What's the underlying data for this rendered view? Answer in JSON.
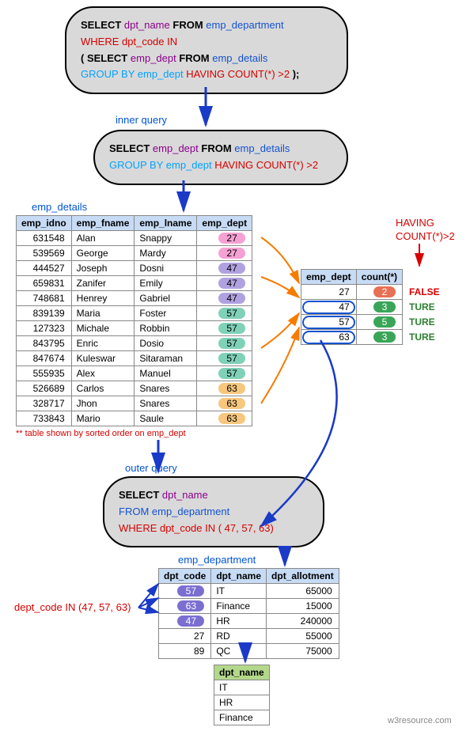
{
  "main_query": {
    "line1_select": "SELECT",
    "line1_col": "dpt_name",
    "line1_from": "FROM",
    "line1_tbl": "emp_department",
    "line2_where": "WHERE",
    "line2_rest": "dpt_code IN",
    "line3_open": "(",
    "line3_select": "SELECT",
    "line3_col": "emp_dept",
    "line3_from": "FROM",
    "line3_tbl": "emp_details",
    "line4_group": "GROUP BY",
    "line4_col": "emp_dept",
    "line4_having": "HAVING COUNT(*) >2",
    "line4_close": ");"
  },
  "labels": {
    "inner_query": "inner query",
    "outer_query": "outer query",
    "emp_details": "emp_details",
    "emp_department": "emp_department",
    "sort_note": "** table shown by sorted order on emp_dept",
    "having_note_l1": "HAVING",
    "having_note_l2": "COUNT(*)>2",
    "dept_in_note": "dept_code IN (47, 57, 63)",
    "footer": "w3resource.com"
  },
  "inner_query": {
    "l1_select": "SELECT",
    "l1_col": "emp_dept",
    "l1_from": "FROM",
    "l1_tbl": "emp_details",
    "l2_group": "GROUP BY",
    "l2_col": "emp_dept",
    "l2_having": "HAVING COUNT(*) >2"
  },
  "outer_query": {
    "l1_select": "SELECT",
    "l1_col": "dpt_name",
    "l2_from": "FROM",
    "l2_tbl": "emp_department",
    "l3_where": "WHERE",
    "l3_rest": "dpt_code IN ( 47, 57, 63)"
  },
  "emp_details": {
    "headers": [
      "emp_idno",
      "emp_fname",
      "emp_lname",
      "emp_dept"
    ],
    "rows": [
      {
        "id": "631548",
        "fn": "Alan",
        "ln": "Snappy",
        "dept": "27"
      },
      {
        "id": "539569",
        "fn": "George",
        "ln": "Mardy",
        "dept": "27"
      },
      {
        "id": "444527",
        "fn": "Joseph",
        "ln": "Dosni",
        "dept": "47"
      },
      {
        "id": "659831",
        "fn": "Zanifer",
        "ln": "Emily",
        "dept": "47"
      },
      {
        "id": "748681",
        "fn": "Henrey",
        "ln": "Gabriel",
        "dept": "47"
      },
      {
        "id": "839139",
        "fn": "Maria",
        "ln": "Foster",
        "dept": "57"
      },
      {
        "id": "127323",
        "fn": "Michale",
        "ln": "Robbin",
        "dept": "57"
      },
      {
        "id": "843795",
        "fn": "Enric",
        "ln": "Dosio",
        "dept": "57"
      },
      {
        "id": "847674",
        "fn": "Kuleswar",
        "ln": "Sitaraman",
        "dept": "57"
      },
      {
        "id": "555935",
        "fn": "Alex",
        "ln": "Manuel",
        "dept": "57"
      },
      {
        "id": "526689",
        "fn": "Carlos",
        "ln": "Snares",
        "dept": "63"
      },
      {
        "id": "328717",
        "fn": "Jhon",
        "ln": "Snares",
        "dept": "63"
      },
      {
        "id": "733843",
        "fn": "Mario",
        "ln": "Saule",
        "dept": "63"
      }
    ]
  },
  "chart_data": {
    "type": "table",
    "title": "emp_dept group counts with HAVING COUNT(*)>2",
    "headers": [
      "emp_dept",
      "count(*)"
    ],
    "rows": [
      {
        "dept": "27",
        "count": "2",
        "ok": false,
        "truth": "FALSE"
      },
      {
        "dept": "47",
        "count": "3",
        "ok": true,
        "truth": "TURE"
      },
      {
        "dept": "57",
        "count": "5",
        "ok": true,
        "truth": "TURE"
      },
      {
        "dept": "63",
        "count": "3",
        "ok": true,
        "truth": "TURE"
      }
    ]
  },
  "emp_department": {
    "headers": [
      "dpt_code",
      "dpt_name",
      "dpt_allotment"
    ],
    "rows": [
      {
        "code": "57",
        "name": "IT",
        "allot": "65000",
        "match": true
      },
      {
        "code": "63",
        "name": "Finance",
        "allot": "15000",
        "match": true
      },
      {
        "code": "47",
        "name": "HR",
        "allot": "240000",
        "match": true
      },
      {
        "code": "27",
        "name": "RD",
        "allot": "55000",
        "match": false
      },
      {
        "code": "89",
        "name": "QC",
        "allot": "75000",
        "match": false
      }
    ]
  },
  "result": {
    "header": "dpt_name",
    "rows": [
      "IT",
      "HR",
      "Finance"
    ]
  }
}
